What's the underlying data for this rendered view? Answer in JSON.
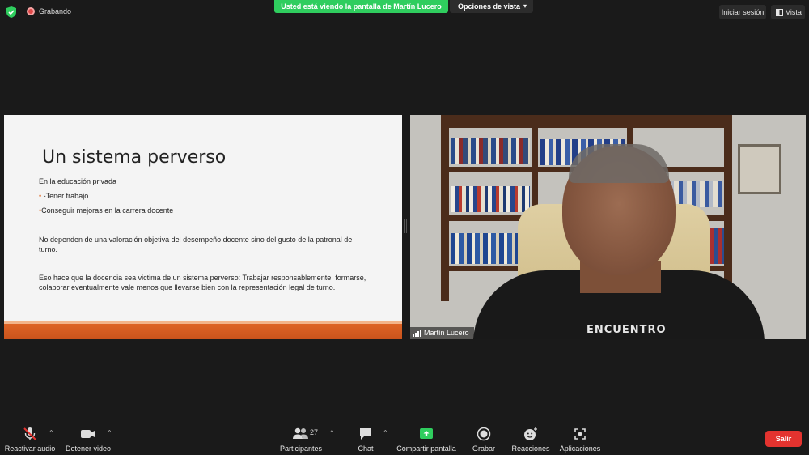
{
  "top": {
    "recording_label": "Grabando",
    "share_banner": "Usted está viendo la pantalla de Martín Lucero",
    "view_options_label": "Opciones de vista",
    "signin_label": "Iniciar sesión",
    "view_label": "Vista",
    "shield_color": "#2fcd5e"
  },
  "slide": {
    "title": "Un sistema perverso",
    "lines": [
      "En la educación privada",
      "-Tener trabajo",
      "Conseguir mejoras en la carrera docente",
      "No dependen de una valoración objetiva del desempeño docente sino del gusto de la patronal de turno.",
      "Eso hace que la docencia sea victima de un sistema perverso: Trabajar responsablemente, formarse, colaborar eventualmente vale menos que llevarse bien con la representación legal de turno."
    ],
    "bullet_char": "•",
    "accent_color": "#de6426"
  },
  "video": {
    "participant_name": "Martín Lucero",
    "shirt_text": "ENCUENTRO"
  },
  "toolbar": {
    "mute_label": "Reactivar audio",
    "video_label": "Detener video",
    "participants_label": "Participantes",
    "participants_count": "27",
    "chat_label": "Chat",
    "share_label": "Compartir pantalla",
    "record_label": "Grabar",
    "reactions_label": "Reacciones",
    "apps_label": "Aplicaciones",
    "leave_label": "Salir",
    "caret_icon": "chevron-up",
    "leave_color": "#e3332f",
    "share_color": "#2fcd5e"
  }
}
